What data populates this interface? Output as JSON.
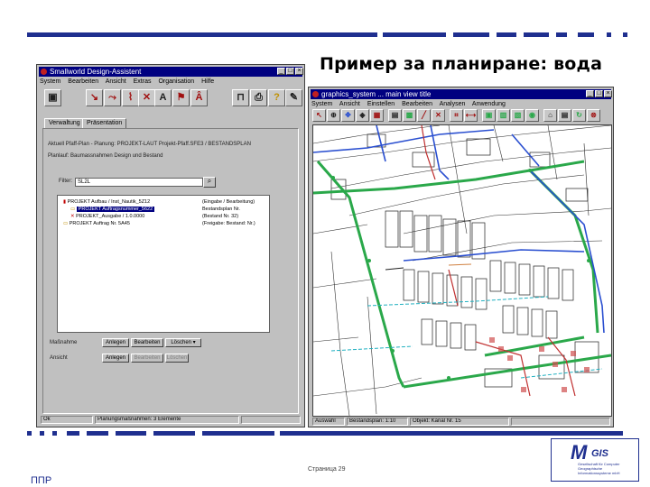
{
  "slide": {
    "title": "Пример за планиране: вода",
    "page_label": "Страница 29",
    "footer_left": "ППР"
  },
  "design_assistant": {
    "title": "Smallworld Design-Assistent",
    "menu": [
      "System",
      "Bearbeiten",
      "Ansicht",
      "Extras",
      "Organisation",
      "Hilfe"
    ],
    "tabs": [
      "Verwaltung",
      "Präsentation"
    ],
    "info_line_1": "Aktuell Pfaff-Plan - Planung: PROJEKT-LAUT Projekt-Pfaff.SFE3 / BESTANDSPLAN",
    "info_line_2": "Planlauf: Baumassnahmen Design und Bestand",
    "filter_label": "Filter:",
    "filter_value": "SL2L",
    "tree_rows": [
      {
        "label": "PROJEKT Aufbau / Inst_Nautik_5Z12",
        "status": "(Eingabe / Bearbeitung)"
      },
      {
        "label": "PROJEKT Auftragsnummer_5622",
        "status": "Bestandsplan Nr."
      },
      {
        "label": "PROJEKT_Ausgabe / 1.0.0000",
        "status": "(Bestand Nr. 32)"
      },
      {
        "label": "PROJEKT Auftrag Nr. 5A45",
        "status": "(Freigabe: Bestand: Nr.)"
      }
    ],
    "row1_label": "Maßnahme",
    "row2_label": "Ansicht",
    "btn_anlegen": "Anlegen",
    "btn_bearbeiten": "Bearbeiten",
    "btn_loeschen": "Löschen",
    "status_left": "Ok",
    "status_mid": "Planungsmaßnahmen: 3 Elemente"
  },
  "graphics_window": {
    "title": "graphics_system ... main view title",
    "menu": [
      "System",
      "Ansicht",
      "Einstellen",
      "Bearbeiten",
      "Analysen",
      "Anwendung"
    ],
    "status_1": "Auswahl",
    "status_2": "Bestandsplan: 1:10",
    "status_3": "Objekt: Kanal Nr. 15"
  },
  "logo": {
    "m": "M",
    "gis": "GIS",
    "subtitle": "Gesellschaft für Computer Geographische Informationssysteme mbH"
  },
  "colors": {
    "brand_blue": "#1f2f8f",
    "window_gray": "#c0c0c0",
    "titlebar_blue": "#000080",
    "map_green": "#2aa84a",
    "map_blue": "#2a4fd0",
    "map_red": "#c03030"
  }
}
